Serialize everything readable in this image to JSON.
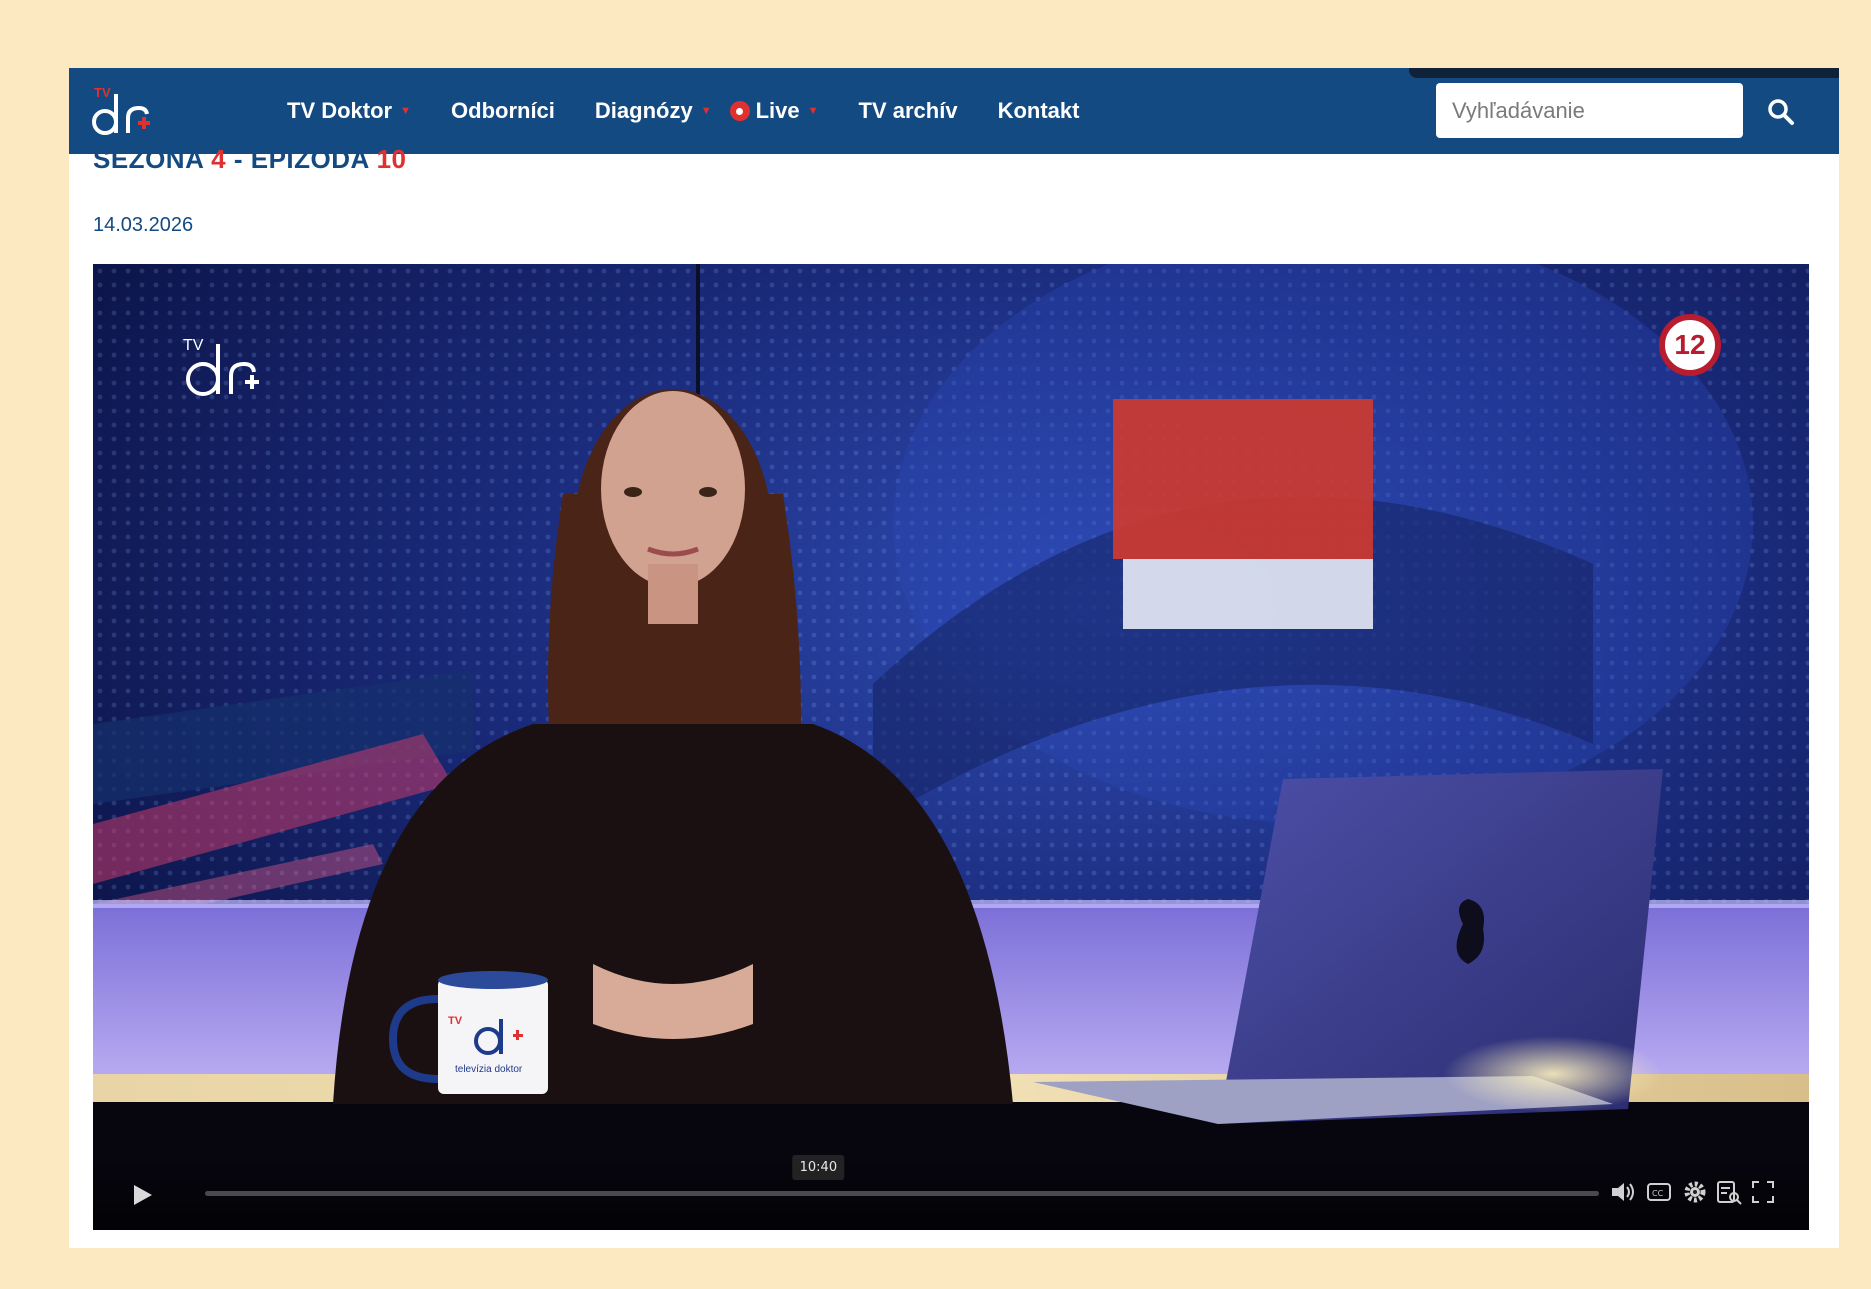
{
  "header": {
    "nav": [
      {
        "label": "TV Doktor",
        "dropdown": true
      },
      {
        "label": "Odborníci",
        "dropdown": false
      },
      {
        "label": "Diagnózy",
        "dropdown": true
      },
      {
        "label": "Live",
        "dropdown": true
      },
      {
        "label": "TV archív",
        "dropdown": false
      },
      {
        "label": "Kontakt",
        "dropdown": false
      }
    ],
    "search": {
      "placeholder": "Vyhľadávanie",
      "value": ""
    }
  },
  "article": {
    "season_label": "SEZÓNA",
    "season_number": "4",
    "separator": " - ",
    "episode_label": "EPIZÓDA",
    "episode_number": "10",
    "date": "14.03.2026"
  },
  "player": {
    "age_rating": "12",
    "hover_time": "10:40",
    "progress": 0.0,
    "hover_fraction": 0.44,
    "mug_text": "televízia doktor",
    "controls": [
      "play-icon",
      "volume-icon",
      "captions-icon",
      "settings-icon",
      "playlist-icon",
      "fullscreen-icon"
    ]
  },
  "colors": {
    "page_bg": "#fde9c1",
    "navbar": "#144a82",
    "accent": "#e03131",
    "badge": "#b81c2f"
  }
}
